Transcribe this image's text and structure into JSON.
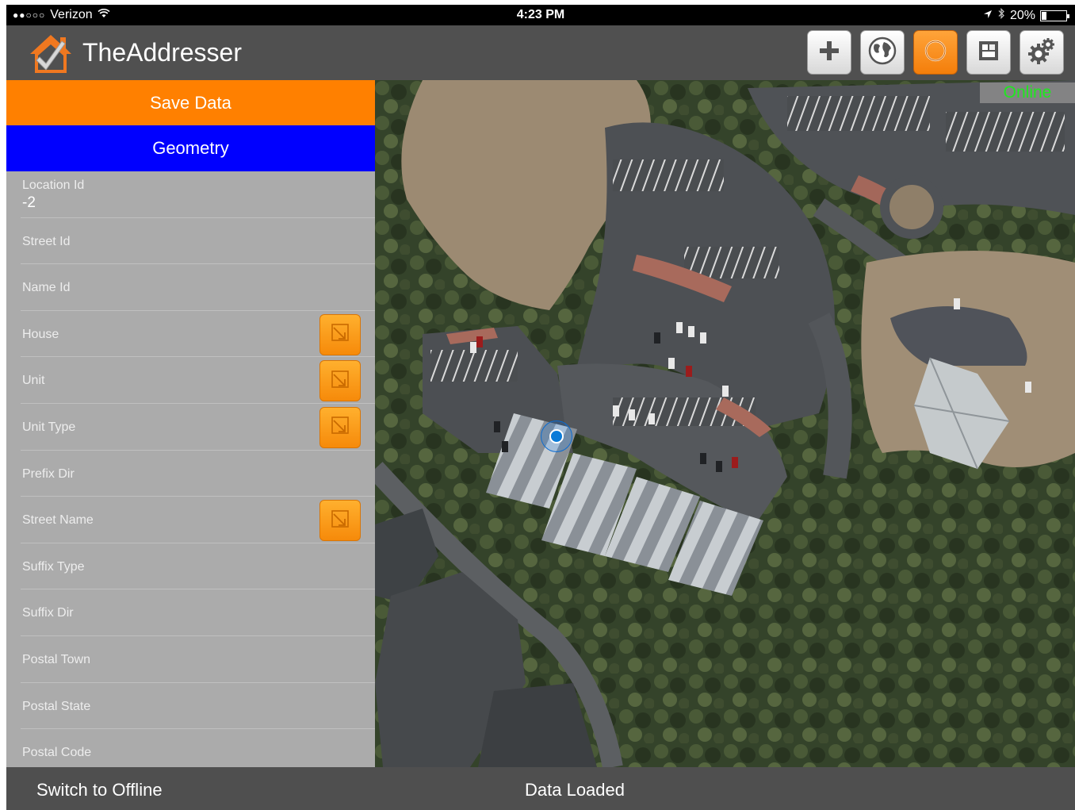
{
  "status_bar": {
    "signal": "●●○○○",
    "carrier": "Verizon",
    "time": "4:23 PM",
    "battery": "20%",
    "battery_level": 0.2
  },
  "header": {
    "title": "TheAddresser",
    "toolbar": [
      {
        "icon": "plus-icon"
      },
      {
        "icon": "globe-icon"
      },
      {
        "icon": "target-icon",
        "active": true
      },
      {
        "icon": "layers-icon"
      },
      {
        "icon": "gears-icon"
      }
    ]
  },
  "panel": {
    "save_label": "Save Data",
    "geometry_label": "Geometry",
    "fields": [
      {
        "label": "Location Id",
        "value": "-2"
      },
      {
        "label": "Street Id"
      },
      {
        "label": "Name Id"
      },
      {
        "label": "House",
        "editable": true
      },
      {
        "label": "Unit",
        "editable": true
      },
      {
        "label": "Unit Type",
        "editable": true
      },
      {
        "label": "Prefix Dir"
      },
      {
        "label": "Street Name",
        "editable": true
      },
      {
        "label": "Suffix Type"
      },
      {
        "label": "Suffix Dir"
      },
      {
        "label": "Postal Town"
      },
      {
        "label": "Postal State"
      },
      {
        "label": "Postal Code"
      }
    ]
  },
  "map": {
    "connection_status": "Online"
  },
  "bottom_bar": {
    "switch_label": "Switch to Offline",
    "status": "Data Loaded"
  },
  "colors": {
    "accent_orange": "#ff8000",
    "geometry_blue": "#0000ff",
    "online_green": "#1fe81f"
  }
}
